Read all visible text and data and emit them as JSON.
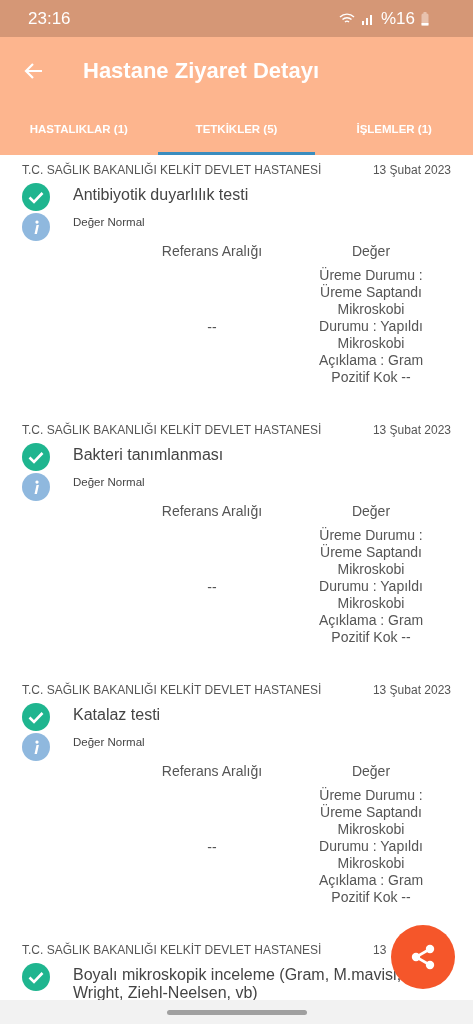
{
  "status_bar": {
    "time": "23:16",
    "battery_text": "%16"
  },
  "app_bar": {
    "title": "Hastane Ziyaret Detayı"
  },
  "tabs": [
    {
      "label": "HASTALIKLAR (1)",
      "selected": false
    },
    {
      "label": "TETKİKLER (5)",
      "selected": true
    },
    {
      "label": "İŞLEMLER (1)",
      "selected": false
    }
  ],
  "tests": [
    {
      "hospital": "T.C. SAĞLIK BAKANLIĞI KELKİT DEVLET HASTANESİ",
      "date": "13 Şubat 2023",
      "name": "Antibiyotik duyarlılık testi",
      "completed": true,
      "status": "Değer Normal",
      "reference_header": "Referans Aralığı",
      "value_header": "Değer",
      "reference": "--",
      "value": "Üreme Durumu : Üreme Saptandı Mikroskobi Durumu : Yapıldı Mikroskobi Açıklama : Gram Pozitif Kok --"
    },
    {
      "hospital": "T.C. SAĞLIK BAKANLIĞI KELKİT DEVLET HASTANESİ",
      "date": "13 Şubat 2023",
      "name": "Bakteri tanımlanması",
      "completed": true,
      "status": "Değer Normal",
      "reference_header": "Referans Aralığı",
      "value_header": "Değer",
      "reference": "--",
      "value": "Üreme Durumu : Üreme Saptandı Mikroskobi Durumu : Yapıldı Mikroskobi Açıklama : Gram Pozitif Kok --"
    },
    {
      "hospital": "T.C. SAĞLIK BAKANLIĞI KELKİT DEVLET HASTANESİ",
      "date": "13 Şubat 2023",
      "name": "Katalaz testi",
      "completed": true,
      "status": "Değer Normal",
      "reference_header": "Referans Aralığı",
      "value_header": "Değer",
      "reference": "--",
      "value": "Üreme Durumu : Üreme Saptandı Mikroskobi Durumu : Yapıldı Mikroskobi Açıklama : Gram Pozitif Kok --"
    },
    {
      "hospital": "T.C. SAĞLIK BAKANLIĞI KELKİT DEVLET HASTANESİ",
      "date": "13",
      "name": "Boyalı mikroskopik inceleme (Gram, M.mavisi, Wright, Ziehl-Neelsen, vb)",
      "completed": true
    }
  ]
}
